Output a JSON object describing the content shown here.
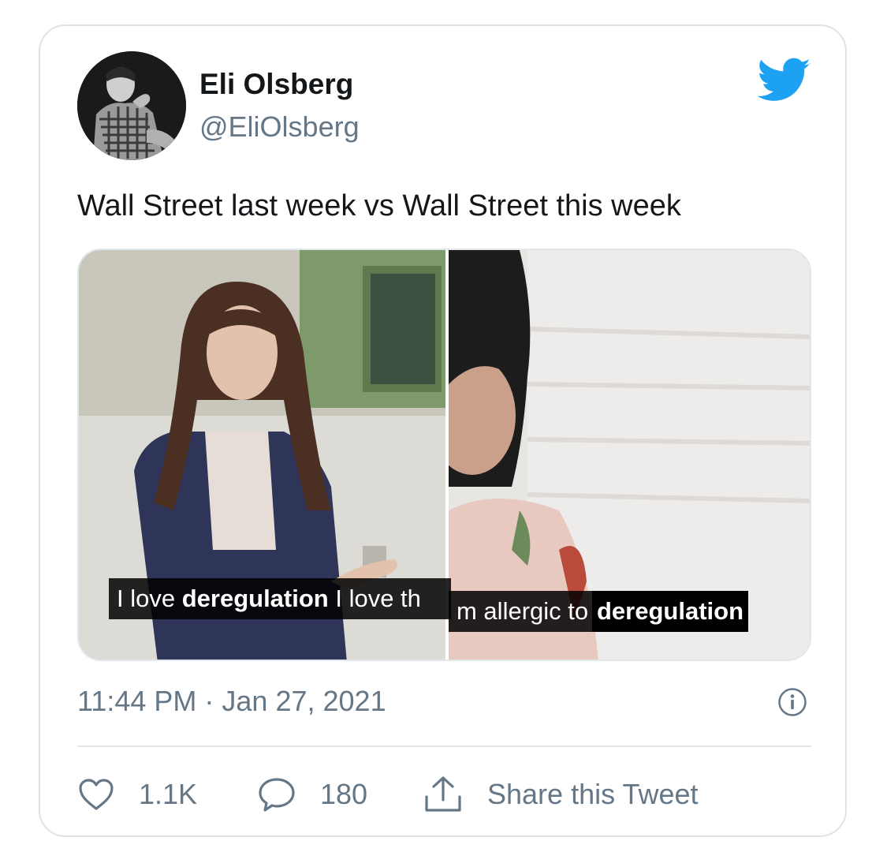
{
  "tweet": {
    "display_name": "Eli Olsberg",
    "handle": "@EliOlsberg",
    "text": "Wall Street last week vs Wall Street this week",
    "timestamp": "11:44 PM · Jan 27, 2021"
  },
  "media": {
    "left_caption_prefix": "I love ",
    "left_caption_bold": "deregulation",
    "left_caption_suffix": " I love th",
    "right_caption_prefix": "m allergic to ",
    "right_caption_bold": "deregulation"
  },
  "actions": {
    "like_count": "1.1K",
    "reply_count": "180",
    "share_label": "Share this Tweet"
  },
  "icons": {
    "brand": "twitter-bird-icon",
    "info": "info-icon",
    "like": "heart-icon",
    "reply": "speech-bubble-icon",
    "share": "share-upload-icon"
  },
  "colors": {
    "twitter_blue": "#1da1f2",
    "secondary_text": "#657786",
    "primary_text": "#14171a"
  }
}
